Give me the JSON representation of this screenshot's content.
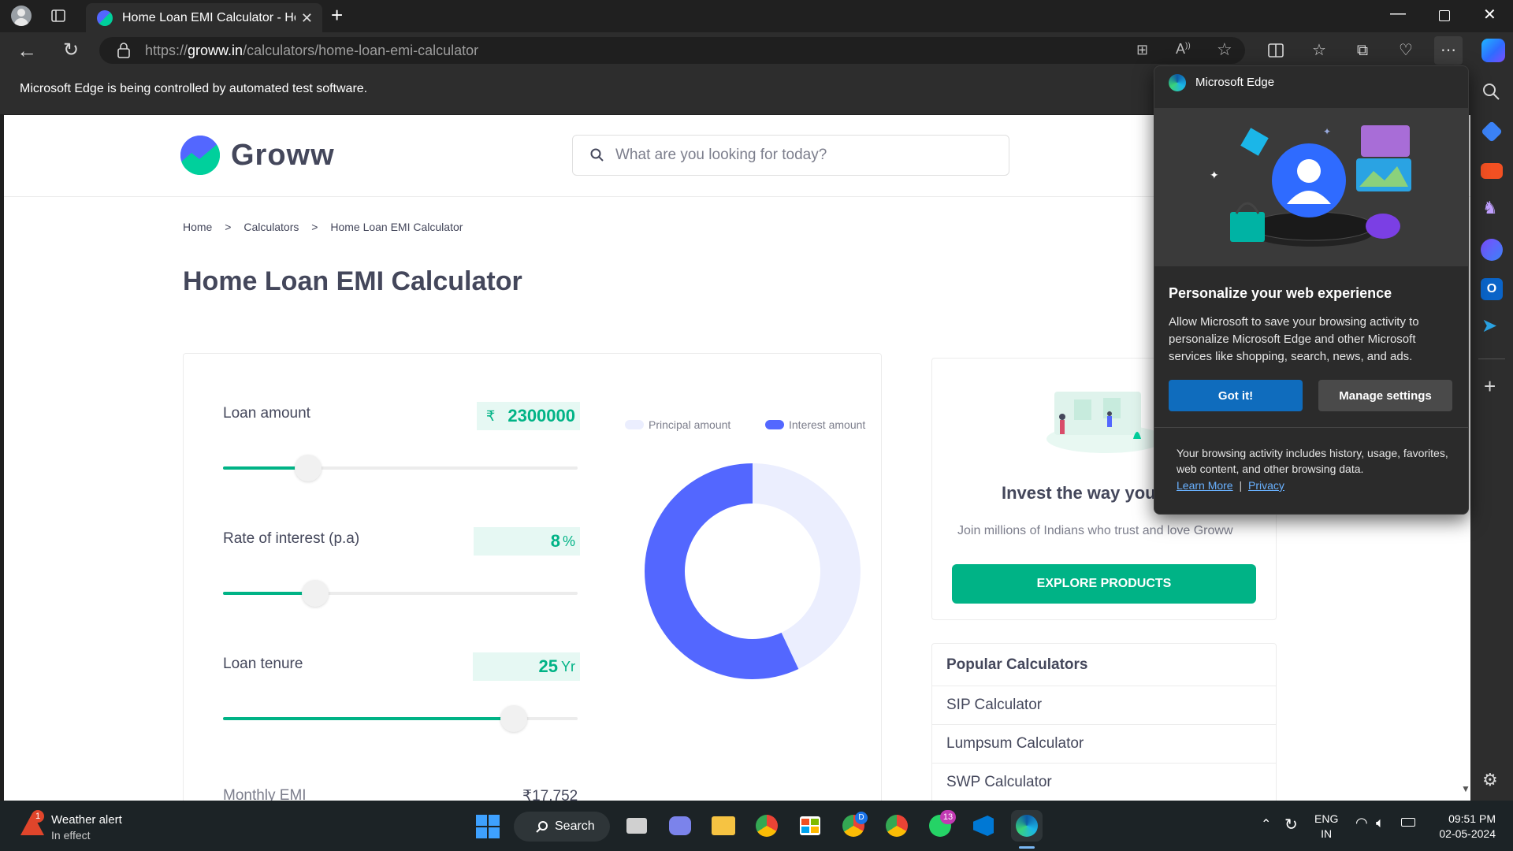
{
  "browser": {
    "tab_title": "Home Loan EMI Calculator - Hou",
    "url_prefix": "https://",
    "url_host": "groww.in",
    "url_path": "/calculators/home-loan-emi-calculator",
    "automation_notice": "Microsoft Edge is being controlled by automated test software."
  },
  "site": {
    "logo_text": "Groww",
    "search_placeholder": "What are you looking for today?"
  },
  "breadcrumb": [
    "Home",
    ">",
    "Calculators",
    ">",
    "Home Loan EMI Calculator"
  ],
  "page_title": "Home Loan EMI Calculator",
  "calculator": {
    "loan_amount_label": "Loan amount",
    "loan_amount_currency": "₹",
    "loan_amount_value": "2300000",
    "loan_amount_slider_fraction": 0.24,
    "rate_label": "Rate of interest (p.a)",
    "rate_value": "8",
    "rate_unit": "%",
    "rate_slider_fraction": 0.26,
    "tenure_label": "Loan tenure",
    "tenure_value": "25",
    "tenure_unit": "Yr",
    "tenure_slider_fraction": 0.82,
    "monthly_emi_label": "Monthly EMI",
    "monthly_emi_value": "₹17,752",
    "legend_principal": "Principal amount",
    "legend_interest": "Interest amount",
    "principal_color": "#ebeefe",
    "interest_color": "#5367ff",
    "principal_share": 0.43,
    "interest_share": 0.57
  },
  "invest_card": {
    "heading": "Invest the way you",
    "subtext": "Join millions of Indians who trust and love Groww",
    "button": "EXPLORE PRODUCTS"
  },
  "popular": {
    "heading": "Popular Calculators",
    "items": [
      "SIP Calculator",
      "Lumpsum Calculator",
      "SWP Calculator"
    ]
  },
  "popup": {
    "app_name": "Microsoft Edge",
    "heading": "Personalize your web experience",
    "body": "Allow Microsoft to save your browsing activity to personalize Microsoft Edge and other Microsoft services like shopping, search, news, and ads.",
    "primary_button": "Got it!",
    "secondary_button": "Manage settings",
    "footnote": "Your browsing activity includes history, usage, favorites, web content, and other browsing data.",
    "learn_more": "Learn More",
    "separator": "|",
    "privacy": "Privacy"
  },
  "taskbar": {
    "weather_title": "Weather alert",
    "weather_sub": "In effect",
    "weather_badge": "1",
    "search_label": "Search",
    "chrome_badge": "D",
    "whatsapp_badge": "13",
    "lang_top": "ENG",
    "lang_bottom": "IN",
    "time": "09:51 PM",
    "date": "02-05-2024"
  },
  "colors": {
    "accent_green": "#00b386",
    "accent_blue": "#5367ff",
    "edge_button_blue": "#0f6cbd"
  }
}
